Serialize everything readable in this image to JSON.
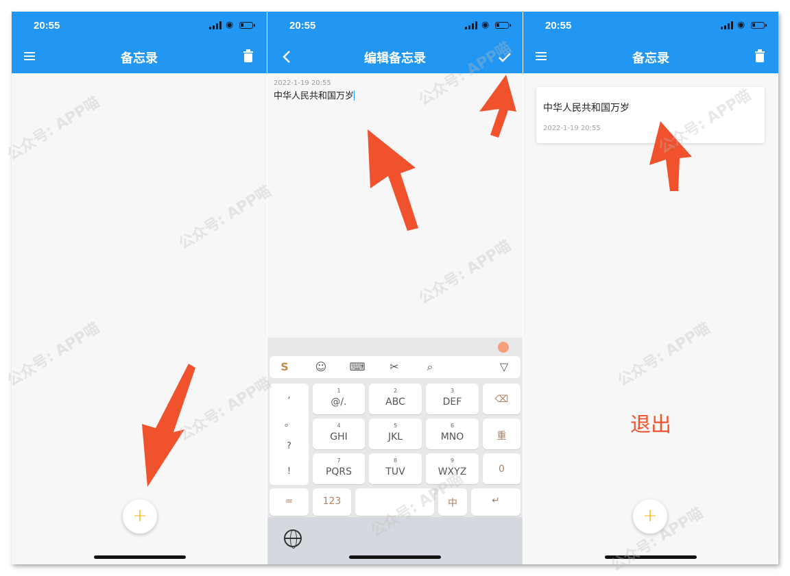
{
  "status": {
    "time": "20:55"
  },
  "screen1": {
    "title": "备忘录",
    "menu_icon": "menu-icon",
    "delete_icon": "trash-icon",
    "fab_label": "+"
  },
  "screen2": {
    "title": "编辑备忘录",
    "back_icon": "chevron-left-icon",
    "confirm_icon": "check-icon",
    "note_date": "2022-1-19 20:55",
    "note_text": "中华人民共和国万岁"
  },
  "screen3": {
    "title": "备忘录",
    "fab_label": "+",
    "note": {
      "title": "中华人民共和国万岁",
      "date": "2022-1-19 20:55"
    },
    "exit_label": "退出"
  },
  "keyboard": {
    "punct": [
      ",",
      "。",
      "?",
      "!"
    ],
    "keys": [
      {
        "num": "1",
        "label": "@/."
      },
      {
        "num": "2",
        "label": "ABC"
      },
      {
        "num": "3",
        "label": "DEF"
      },
      {
        "num": "4",
        "label": "GHI"
      },
      {
        "num": "5",
        "label": "JKL"
      },
      {
        "num": "6",
        "label": "MNO"
      },
      {
        "num": "7",
        "label": "PQRS"
      },
      {
        "num": "8",
        "label": "TUV"
      },
      {
        "num": "9",
        "label": "WXYZ"
      }
    ],
    "fn_delete": "⌫",
    "fn_redo": "重",
    "fn_zero": "0",
    "fn_equals": "=",
    "fn_123": "123",
    "fn_zh": "中",
    "fn_enter": "↵"
  },
  "watermark": "公众号: APP喵",
  "colors": {
    "appbar": "#2196f3",
    "fab_plus": "#f5b400",
    "arrow": "#f0522e",
    "exit": "#f0522e"
  }
}
